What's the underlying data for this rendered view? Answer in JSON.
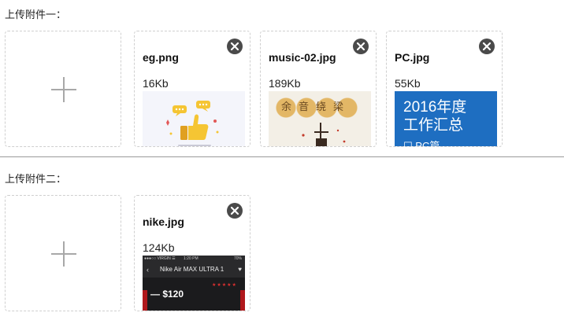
{
  "section1": {
    "label": "上传附件一：",
    "files": [
      {
        "name": "eg.png",
        "size": "16Kb"
      },
      {
        "name": "music-02.jpg",
        "size": "189Kb",
        "thumb_text": "余音绕梁"
      },
      {
        "name": "PC.jpg",
        "size": "55Kb",
        "thumb_line1": "2016年度",
        "thumb_line2": "工作汇总",
        "thumb_line3": "☐ PC篇"
      }
    ]
  },
  "section2": {
    "label": "上传附件二：",
    "files": [
      {
        "name": "nike.jpg",
        "size": "124Kb",
        "thumb_status": "●●●○○ VIRGIN ☰",
        "thumb_time": "1:20 PM",
        "thumb_battery": "70%",
        "thumb_title": "Nike Air MAX ULTRA 1",
        "thumb_price": "— $120"
      }
    ]
  },
  "icons": {
    "add": "plus-icon",
    "remove": "close-icon"
  },
  "colors": {
    "pc_blue": "#1e6ec1",
    "close_bg": "#4a4a4a",
    "border": "#cfcfcf",
    "thumbs_gold": "#f5c533"
  }
}
